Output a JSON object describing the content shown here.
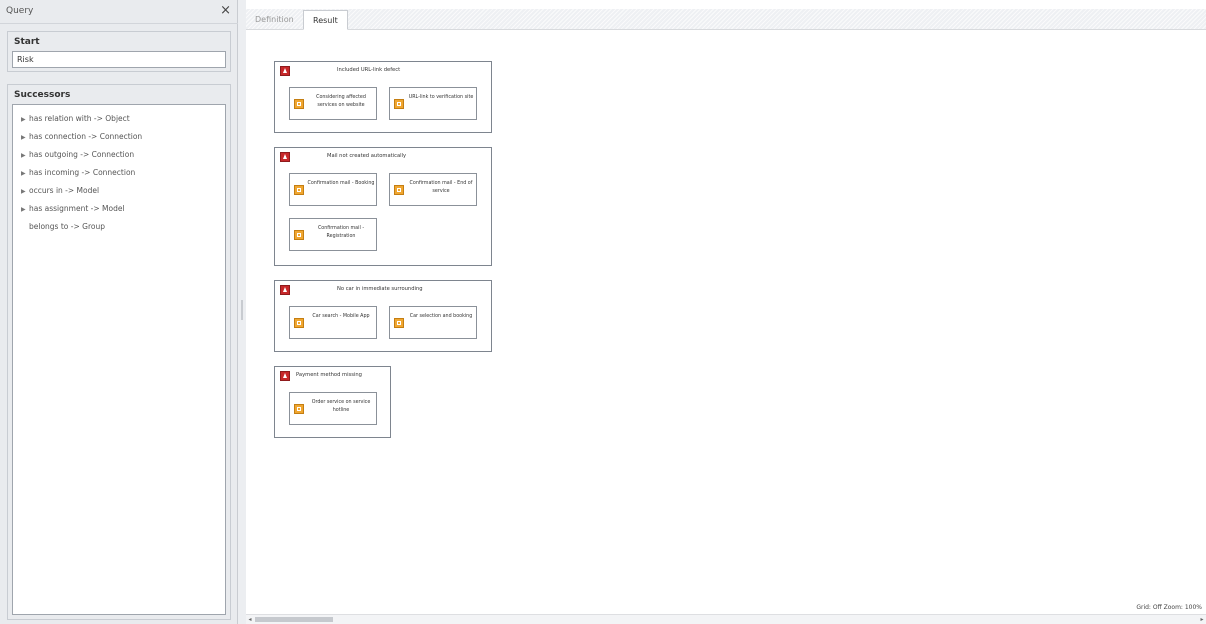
{
  "query_panel": {
    "title": "Query",
    "close_icon": "close-icon",
    "start": {
      "label": "Start",
      "value": "Risk"
    },
    "successors": {
      "label": "Successors",
      "items": [
        {
          "label": "has relation with -> Object",
          "expandable": true
        },
        {
          "label": "has connection -> Connection",
          "expandable": true
        },
        {
          "label": "has outgoing -> Connection",
          "expandable": true
        },
        {
          "label": "has incoming -> Connection",
          "expandable": true
        },
        {
          "label": "occurs in -> Model",
          "expandable": true
        },
        {
          "label": "has assignment -> Model",
          "expandable": true
        },
        {
          "label": "belongs to -> Group",
          "expandable": false
        }
      ]
    }
  },
  "tabs": [
    {
      "label": "Definition",
      "active": false
    },
    {
      "label": "Result",
      "active": true
    }
  ],
  "result": {
    "groups": [
      {
        "title": "Included URL-link defect",
        "icon": "risk-icon",
        "items": [
          "Considering affected services on website",
          "URL-link to verification site"
        ]
      },
      {
        "title": "Mail not created automatically",
        "icon": "risk-icon",
        "items": [
          "Confirmation mail - Booking",
          "Confirmation mail - End of service",
          "Confirmation mail - Registration"
        ]
      },
      {
        "title": "No car in immediate surrounding",
        "icon": "risk-icon",
        "items": [
          "Car search - Mobile App",
          "Car selection and booking"
        ]
      },
      {
        "title": "Payment method missing",
        "icon": "risk-icon",
        "items": [
          "Order service on service hotline"
        ]
      }
    ]
  },
  "status": {
    "text": "Grid: Off  Zoom: 100%"
  },
  "colors": {
    "risk": "#c7282a",
    "service": "#f0a630",
    "panel": "#e9ebee"
  }
}
